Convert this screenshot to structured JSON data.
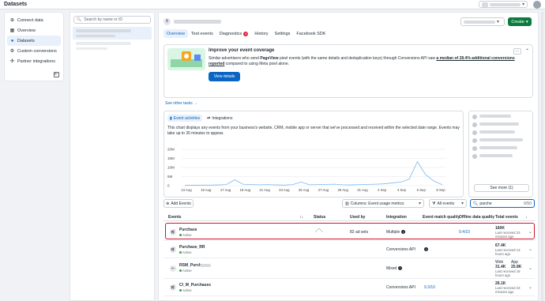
{
  "app": {
    "title": "Datasets"
  },
  "nav": {
    "items": [
      {
        "label": "Connect data",
        "icon": "plus-circle-icon",
        "active": false
      },
      {
        "label": "Overview",
        "icon": "grid-icon",
        "active": false
      },
      {
        "label": "Datasets",
        "icon": "people-icon",
        "active": true
      },
      {
        "label": "Custom conversions",
        "icon": "gear-icon",
        "active": false
      },
      {
        "label": "Partner integrations",
        "icon": "puzzle-icon",
        "active": false
      }
    ]
  },
  "list": {
    "search_placeholder": "Search by name or ID"
  },
  "main": {
    "create_label": "Create",
    "tabs": [
      {
        "label": "Overview",
        "active": true
      },
      {
        "label": "Test events",
        "active": false
      },
      {
        "label": "Diagnostics",
        "active": false,
        "badge": "4"
      },
      {
        "label": "History",
        "active": false
      },
      {
        "label": "Settings",
        "active": false
      },
      {
        "label": "Facebook SDK",
        "active": false
      }
    ]
  },
  "coverage": {
    "title": "Improve your event coverage",
    "text_before": "Similar advertisers who send ",
    "text_event": "PageView",
    "text_mid": " pixel events (with the same details and deduplication keys) through Conversions API saw ",
    "text_highlight": "a median of 28.4% additional conversions reported",
    "text_after": " compared to using Meta pixel alone.",
    "button": "View details",
    "more": "...",
    "see_tasks": "See other tasks →"
  },
  "activity": {
    "tab_activities": "Event activities",
    "tab_integrations": "Integrations",
    "description": "This chart displays any events from your business's website, CRM, mobile app or server that we've processed and received within the selected date range. Events may take up to 30 minutes to appear."
  },
  "chart_data": {
    "type": "line",
    "x": [
      "13 Aug",
      "15 Aug",
      "17 Aug",
      "19 Aug",
      "21 Aug",
      "23 Aug",
      "25 Aug",
      "27 Aug",
      "29 Aug",
      "31 Aug",
      "2 Sep",
      "4 Sep",
      "6 Sep",
      "8 Sep"
    ],
    "series": [
      {
        "values": [
          0.2,
          0.2,
          0.3,
          0.3,
          0.4,
          0.6,
          3.2,
          0.8,
          0.6,
          0.5,
          0.6,
          0.4,
          0.3,
          0.6,
          2.0,
          0.5,
          0.6,
          0.7,
          0.8,
          0.5,
          0.4,
          0.6,
          0.7,
          0.8,
          1.0,
          1.5,
          2.0,
          3.5,
          13.2,
          6.0,
          2.5,
          0.5
        ]
      }
    ],
    "y_ticks": [
      "20M",
      "15M",
      "10M",
      "5M",
      "0"
    ],
    "ylim": [
      0,
      20
    ],
    "color": "#7ab8f0"
  },
  "sidecard": {
    "see_more": "See more (1)"
  },
  "toolbar": {
    "add_events": "Add Events",
    "columns": "Columns: Event usage metrics",
    "events_filter": "All events",
    "search_value": "parche",
    "search_count": "6/50"
  },
  "table": {
    "headers": {
      "events": "Events",
      "status": "Status",
      "used_by": "Used by",
      "integration": "Integration",
      "emq": "Event match quality",
      "freshness": "Offline data quality",
      "total": "Total events"
    },
    "rows": [
      {
        "name": "Purchase",
        "status": "Active",
        "used_by": "82 ad sets",
        "integration": "Multiple",
        "emq": "9.4/10",
        "total": "160K",
        "total_sub": "Last received 23 minutes ago",
        "icon": "cart-icon"
      },
      {
        "name": "Purchase_RR",
        "status": "Active",
        "used_by": "",
        "integration": "Conversions API",
        "emq": "",
        "total": "67.4K",
        "total_sub": "Last received 13 hours ago",
        "icon": "cart-icon"
      },
      {
        "name": "RSM_Purchase",
        "status": "Active",
        "used_by": "",
        "integration": "Mixed",
        "emq": "",
        "total_web": "Web",
        "total_web_val": "31.4K",
        "total_app": "App",
        "total_app_val": "25.8K",
        "total_sub": "Last received 18 hours ago",
        "icon": "tag-icon"
      },
      {
        "name": "Cl_M_Purchases",
        "status": "Active",
        "used_by": "",
        "integration": "Conversions API",
        "emq": "9.3/10",
        "total": "26.1K",
        "total_sub": "Last received 23 minutes ago",
        "icon": "cart-icon"
      }
    ]
  }
}
